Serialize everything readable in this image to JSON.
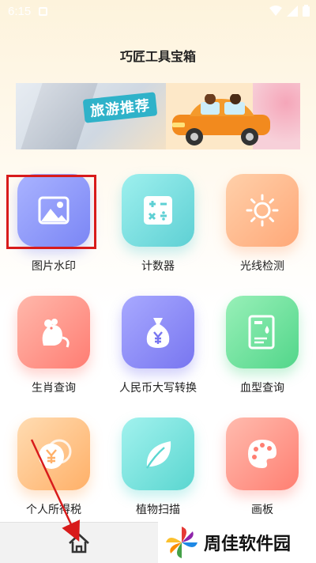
{
  "status_bar": {
    "time": "6:15"
  },
  "app": {
    "title": "巧匠工具宝箱"
  },
  "banner": {
    "slogan": "旅游推荐"
  },
  "tools": [
    {
      "label": "图片水印",
      "icon": "image-icon",
      "color_from": "#9aa6ff",
      "color_to": "#7b86f5"
    },
    {
      "label": "计数器",
      "icon": "calculator-icon",
      "color_from": "#8fe6e6",
      "color_to": "#5ed0d4"
    },
    {
      "label": "光线检测",
      "icon": "sun-icon",
      "color_from": "#ffc9a0",
      "color_to": "#ffa878"
    },
    {
      "label": "生肖查询",
      "icon": "rat-icon",
      "color_from": "#ffb1a5",
      "color_to": "#ff7d73"
    },
    {
      "label": "人民币大写转换",
      "icon": "money-bag-icon",
      "color_from": "#a3a4ff",
      "color_to": "#7876f0"
    },
    {
      "label": "血型查询",
      "icon": "blood-drop-icon",
      "color_from": "#8ff0b0",
      "color_to": "#52d68a"
    },
    {
      "label": "个人所得税",
      "icon": "yuan-coin-icon",
      "color_from": "#ffd7a8",
      "color_to": "#ffb068"
    },
    {
      "label": "植物扫描",
      "icon": "leaf-icon",
      "color_from": "#9cf0ec",
      "color_to": "#5ad6d0"
    },
    {
      "label": "画板",
      "icon": "palette-icon",
      "color_from": "#ffb4a5",
      "color_to": "#ff7f72"
    }
  ],
  "bottom_nav": {
    "home_icon": "home-icon"
  },
  "watermark": {
    "text": "周佳软件园"
  }
}
